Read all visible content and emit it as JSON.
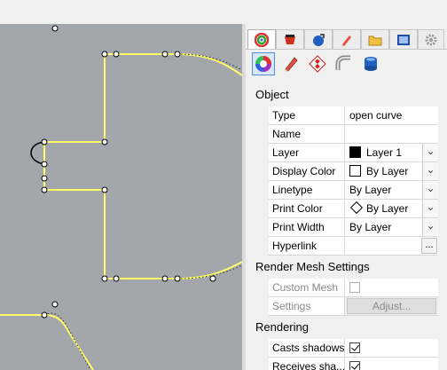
{
  "properties_panel": {
    "tabs": [
      {
        "icon": "object-properties-icon",
        "active": true
      },
      {
        "icon": "material-icon",
        "active": false
      },
      {
        "icon": "environment-icon",
        "active": false
      },
      {
        "icon": "display-mode-icon",
        "active": false
      },
      {
        "icon": "layers-folder-icon",
        "active": false
      },
      {
        "icon": "named-views-icon",
        "active": false
      },
      {
        "icon": "gear-icon",
        "active": false
      }
    ],
    "sub_icons": [
      {
        "icon": "object-color-wheel-icon",
        "active": true
      },
      {
        "icon": "pencil-icon",
        "active": false
      },
      {
        "icon": "texture-mapping-icon",
        "active": false
      },
      {
        "icon": "curve-piping-icon",
        "active": false
      },
      {
        "icon": "database-icon",
        "active": false
      }
    ],
    "object_section": {
      "title": "Object",
      "rows": [
        {
          "name": "Type",
          "value": "open curve"
        },
        {
          "name": "Name",
          "value": ""
        },
        {
          "name": "Layer",
          "value": "Layer 1",
          "swatch": "#000000"
        },
        {
          "name": "Display Color",
          "value": "By Layer",
          "swatch": "#ffffff"
        },
        {
          "name": "Linetype",
          "value": "By Layer"
        },
        {
          "name": "Print Color",
          "value": "By Layer"
        },
        {
          "name": "Print Width",
          "value": "By Layer"
        },
        {
          "name": "Hyperlink",
          "value": "",
          "button": "..."
        }
      ]
    },
    "render_mesh_section": {
      "title": "Render Mesh Settings",
      "custom_mesh_label": "Custom Mesh",
      "custom_mesh_checked": false,
      "settings_label": "Settings",
      "adjust_button": "Adjust..."
    },
    "rendering_section": {
      "title": "Rendering",
      "casts_shadows_label": "Casts shadows",
      "casts_shadows_checked": true,
      "receives_shadows_label": "Receives sha...",
      "receives_shadows_checked": true
    }
  },
  "viewport": {
    "background": "#a3a6ab",
    "curve_color": "#ffff66"
  }
}
